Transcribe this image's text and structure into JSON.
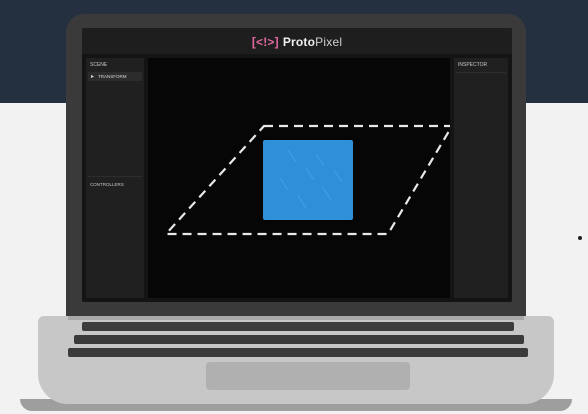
{
  "app": {
    "logo": "[<!>]",
    "title_bold": "Proto",
    "title_light": "Pixel"
  },
  "left_panel": {
    "header": "SCENE",
    "item": "TRANSFORM",
    "controls_header": "CONTROLLERS"
  },
  "right_panel": {
    "header": "INSPECTOR"
  },
  "canvas": {
    "object_color": "#2f8fd8",
    "outline_color": "#e8e8e8"
  }
}
